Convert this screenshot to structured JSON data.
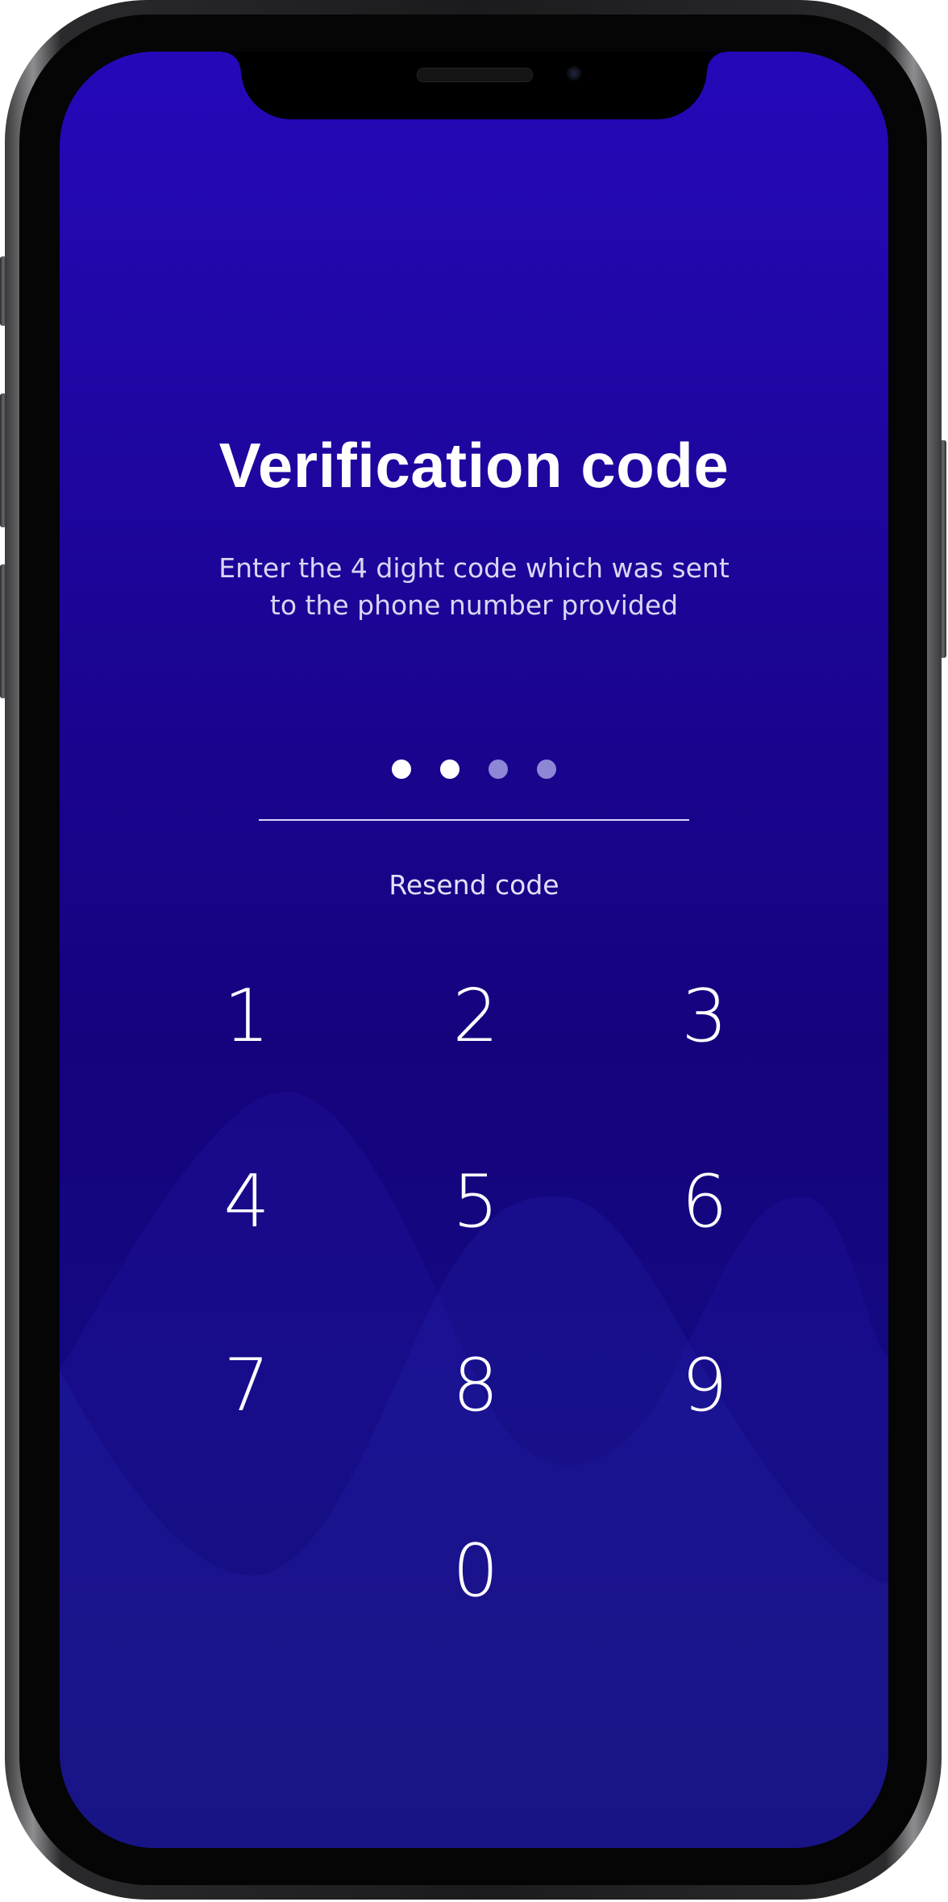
{
  "screen": {
    "title": "Verification code",
    "subtitle_line1": "Enter the 4 dight code which was sent",
    "subtitle_line2": "to the phone number provided",
    "code_dots": {
      "total": 4,
      "filled": 2
    },
    "resend_label": "Resend code",
    "keypad": [
      "1",
      "2",
      "3",
      "4",
      "5",
      "6",
      "7",
      "8",
      "9",
      "0"
    ]
  },
  "colors": {
    "background_top": "#2509b9",
    "background_bottom": "#100c6c",
    "text": "#ffffff",
    "dot_empty": "#8e87d6"
  }
}
